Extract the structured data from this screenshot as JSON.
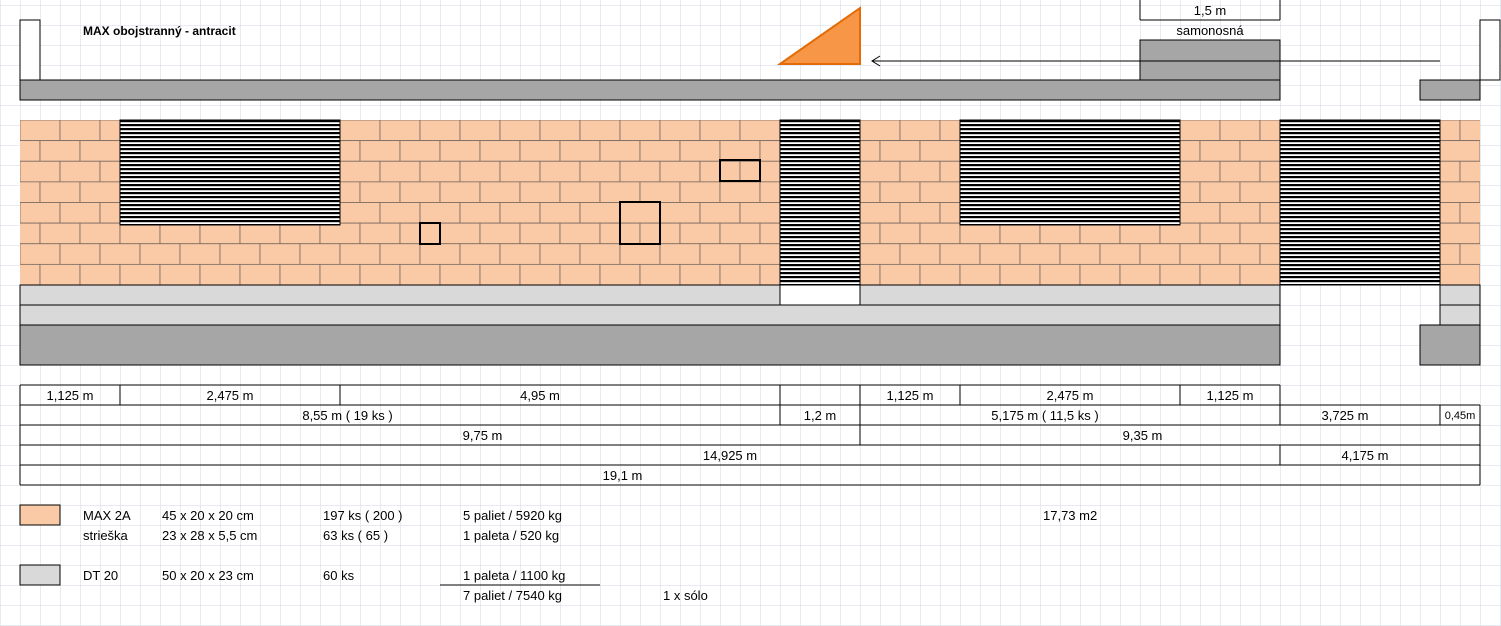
{
  "title": "MAX obojstranný - antracit",
  "gate_label": {
    "width": "1,5 m",
    "type": "samonosná"
  },
  "colors": {
    "brick": "#FAC9A6",
    "brick_line": "#7a6a60",
    "coping_light": "#D9D9D9",
    "dark_gray": "#A6A6A6",
    "triangle": "#F79646",
    "triangle_stroke": "#E36C09",
    "grid": "#D0D7E5"
  },
  "dimensions": {
    "row1": [
      "1,125 m",
      "2,475 m",
      "4,95 m",
      "1,125 m",
      "2,475 m",
      "1,125 m"
    ],
    "row2": [
      "8,55 m ( 19 ks )",
      "1,2 m",
      "5,175 m ( 11,5 ks )",
      "3,725 m",
      "0,45m"
    ],
    "row3": [
      "9,75 m",
      "9,35 m"
    ],
    "row4": [
      "14,925 m",
      "4,175 m"
    ],
    "row5": [
      "19,1 m"
    ]
  },
  "legend": {
    "max": {
      "name": "MAX 2A",
      "size": "45 x 20 x 20 cm",
      "qty": "197 ks ( 200 )",
      "pallets": "5 paliet / 5920 kg",
      "area": "17,73 m2"
    },
    "strieska": {
      "name": "strieška",
      "size": "23 x 28 x 5,5 cm",
      "qty": "63 ks ( 65 )",
      "pallets": "1 paleta / 520 kg"
    },
    "dt": {
      "name": "DT 20",
      "size": "50 x 20 x 23 cm",
      "qty": "60 ks",
      "pallets": "1 paleta / 1100 kg"
    },
    "total": "7 paliet / 7540 kg",
    "transport": "1 x sólo"
  }
}
